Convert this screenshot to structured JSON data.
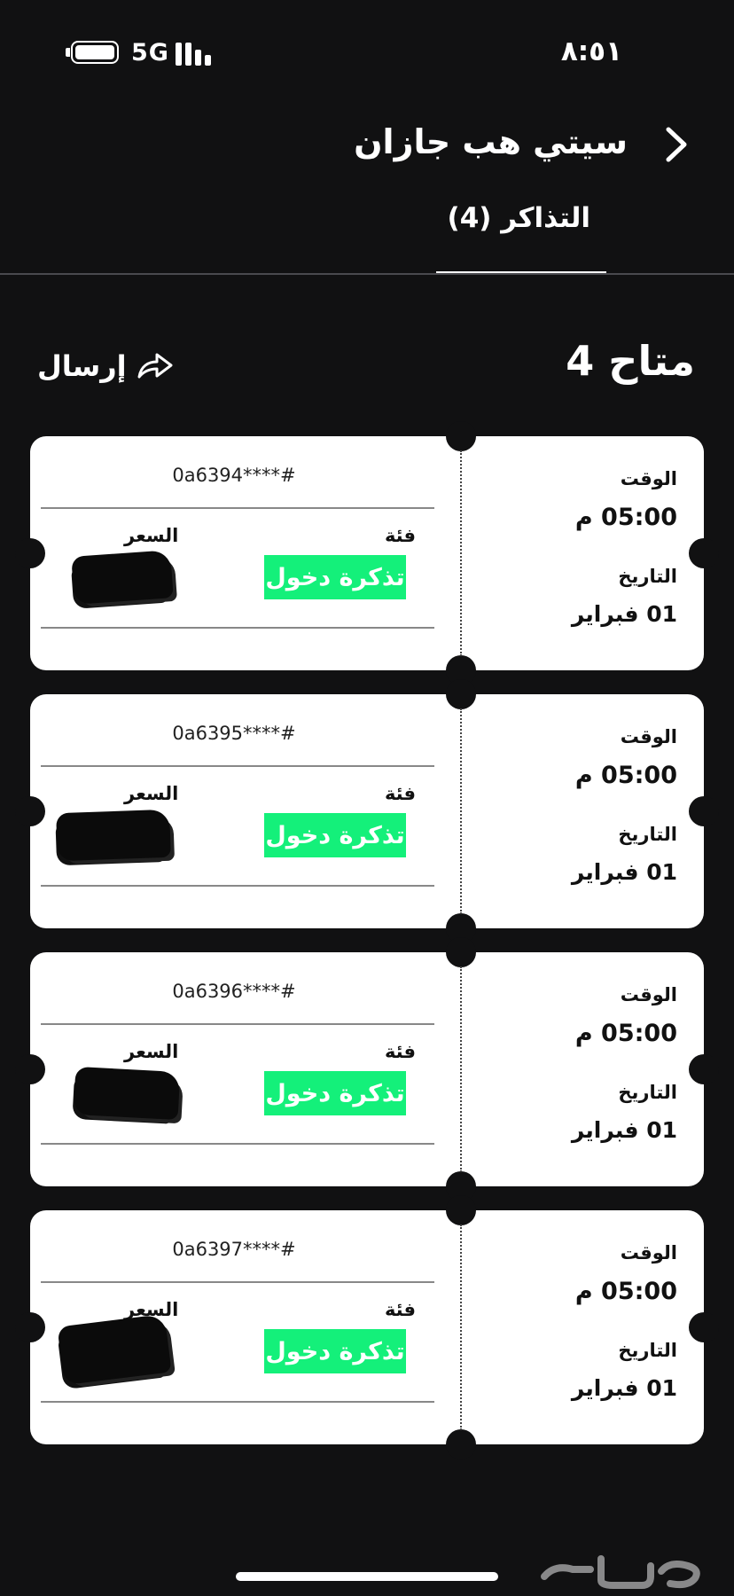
{
  "status_bar": {
    "network": "5G",
    "time": "٨:٥١"
  },
  "header": {
    "title": "سيتي هب جازان",
    "tab_label": "التذاكر (4)"
  },
  "gate": {
    "title": "متاح 4",
    "send_label": "إرسال"
  },
  "tickets": [
    {
      "code": "0a6394****#",
      "time_label": "الوقت",
      "time": "05:00 م",
      "date_label": "التاريخ",
      "date": "01 فبراير",
      "category_label": "فئة",
      "category": "تذكرة دخول",
      "price_label": "السعر"
    },
    {
      "code": "0a6395****#",
      "time_label": "الوقت",
      "time": "05:00 م",
      "date_label": "التاريخ",
      "date": "01 فبراير",
      "category_label": "فئة",
      "category": "تذكرة دخول",
      "price_label": "السعر"
    },
    {
      "code": "0a6396****#",
      "time_label": "الوقت",
      "time": "05:00 م",
      "date_label": "التاريخ",
      "date": "01 فبراير",
      "category_label": "فئة",
      "category": "تذكرة دخول",
      "price_label": "السعر"
    },
    {
      "code": "0a6397****#",
      "time_label": "الوقت",
      "time": "05:00 م",
      "date_label": "التاريخ",
      "date": "01 فبراير",
      "category_label": "فئة",
      "category": "تذكرة دخول",
      "price_label": "السعر"
    }
  ],
  "colors": {
    "background": "#111112",
    "ticket": "#ffffff",
    "badge": "#14f07a"
  },
  "icons": [
    "battery-icon",
    "signal-icon",
    "back-chevron-icon",
    "share-icon",
    "watermark-logo"
  ]
}
